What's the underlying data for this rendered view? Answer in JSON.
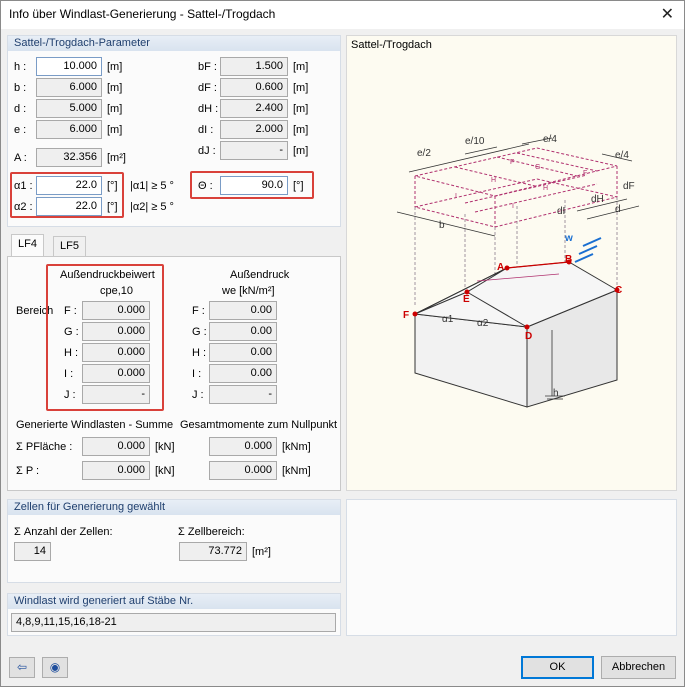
{
  "window": {
    "title": "Info über Windlast-Generierung  -  Sattel-/Trogdach",
    "close_glyph": "✕"
  },
  "params": {
    "header": "Sattel-/Trogdach-Parameter",
    "rows_left": [
      {
        "label": "h :",
        "value": "10.000",
        "unit": "[m]"
      },
      {
        "label": "b :",
        "value": "6.000",
        "unit": "[m]"
      },
      {
        "label": "d :",
        "value": "5.000",
        "unit": "[m]"
      },
      {
        "label": "e :",
        "value": "6.000",
        "unit": "[m]"
      }
    ],
    "area": {
      "label": "A :",
      "value": "32.356",
      "unit": "[m²]"
    },
    "rows_right": [
      {
        "label": "bF :",
        "value": "1.500",
        "unit": "[m]"
      },
      {
        "label": "dF :",
        "value": "0.600",
        "unit": "[m]"
      },
      {
        "label": "dH :",
        "value": "2.400",
        "unit": "[m]"
      },
      {
        "label": "dI :",
        "value": "2.000",
        "unit": "[m]"
      },
      {
        "label": "dJ :",
        "value": "-",
        "unit": "[m]"
      }
    ],
    "alpha1": {
      "label": "α1 :",
      "value": "22.0",
      "unit": "[°]",
      "cond": "|α1| ≥ 5 °"
    },
    "alpha2": {
      "label": "α2 :",
      "value": "22.0",
      "unit": "[°]",
      "cond": "|α2| ≥ 5 °"
    },
    "theta": {
      "label": "Θ :",
      "value": "90.0",
      "unit": "[°]"
    }
  },
  "diagram": {
    "title": "Sattel-/Trogdach",
    "labels": {
      "e2": "e/2",
      "e10": "e/10",
      "e4a": "e/4",
      "e4b": "e/4",
      "b": "b",
      "d": "d",
      "dF": "dF",
      "dH": "dH",
      "dI": "dI",
      "F": "F",
      "G": "G",
      "H": "H",
      "I": "I",
      "w": "w",
      "h": "h",
      "a1": "α1",
      "a2": "α2",
      "pA": "A",
      "pB": "B",
      "pC": "C",
      "pD": "D",
      "pE": "E",
      "pF": "F"
    }
  },
  "tabs": [
    "LF4",
    "LF5"
  ],
  "coeffs": {
    "bereich": "Bereich",
    "col1_title": "Außendruckbeiwert",
    "col1_sub": "cpe,10",
    "col2_title": "Außendruck",
    "col2_sub": "we [kN/m²]",
    "rows": [
      {
        "label": "F :",
        "cpe": "0.000",
        "we": "0.00"
      },
      {
        "label": "G :",
        "cpe": "0.000",
        "we": "0.00"
      },
      {
        "label": "H :",
        "cpe": "0.000",
        "we": "0.00"
      },
      {
        "label": "I :",
        "cpe": "0.000",
        "we": "0.00"
      },
      {
        "label": "J :",
        "cpe": "-",
        "we": "-"
      }
    ],
    "sum_title": "Generierte Windlasten - Summe",
    "moment_title": "Gesamtmomente zum Nullpunkt",
    "sum_rows": [
      {
        "label": "Σ PFläche :",
        "value": "0.000",
        "unit": "[kN]",
        "mvalue": "0.000",
        "munit": "[kNm]"
      },
      {
        "label": "Σ P :",
        "value": "0.000",
        "unit": "[kN]",
        "mvalue": "0.000",
        "munit": "[kNm]"
      }
    ]
  },
  "cells": {
    "header": "Zellen für Generierung gewählt",
    "count_label": "Σ Anzahl der Zellen:",
    "count_value": "14",
    "area_label": "Σ Zellbereich:",
    "area_value": "73.772",
    "area_unit": "[m²]"
  },
  "members": {
    "header": "Windlast wird generiert auf Stäbe Nr.",
    "value": "4,8,9,11,15,16,18-21"
  },
  "footer": {
    "ok": "OK",
    "cancel": "Abbrechen"
  },
  "colors": {
    "accent_red": "#d9413a",
    "diagram_red": "#cc0000",
    "zone_pink": "#b0306e",
    "wind_blue": "#1a6fd1"
  }
}
